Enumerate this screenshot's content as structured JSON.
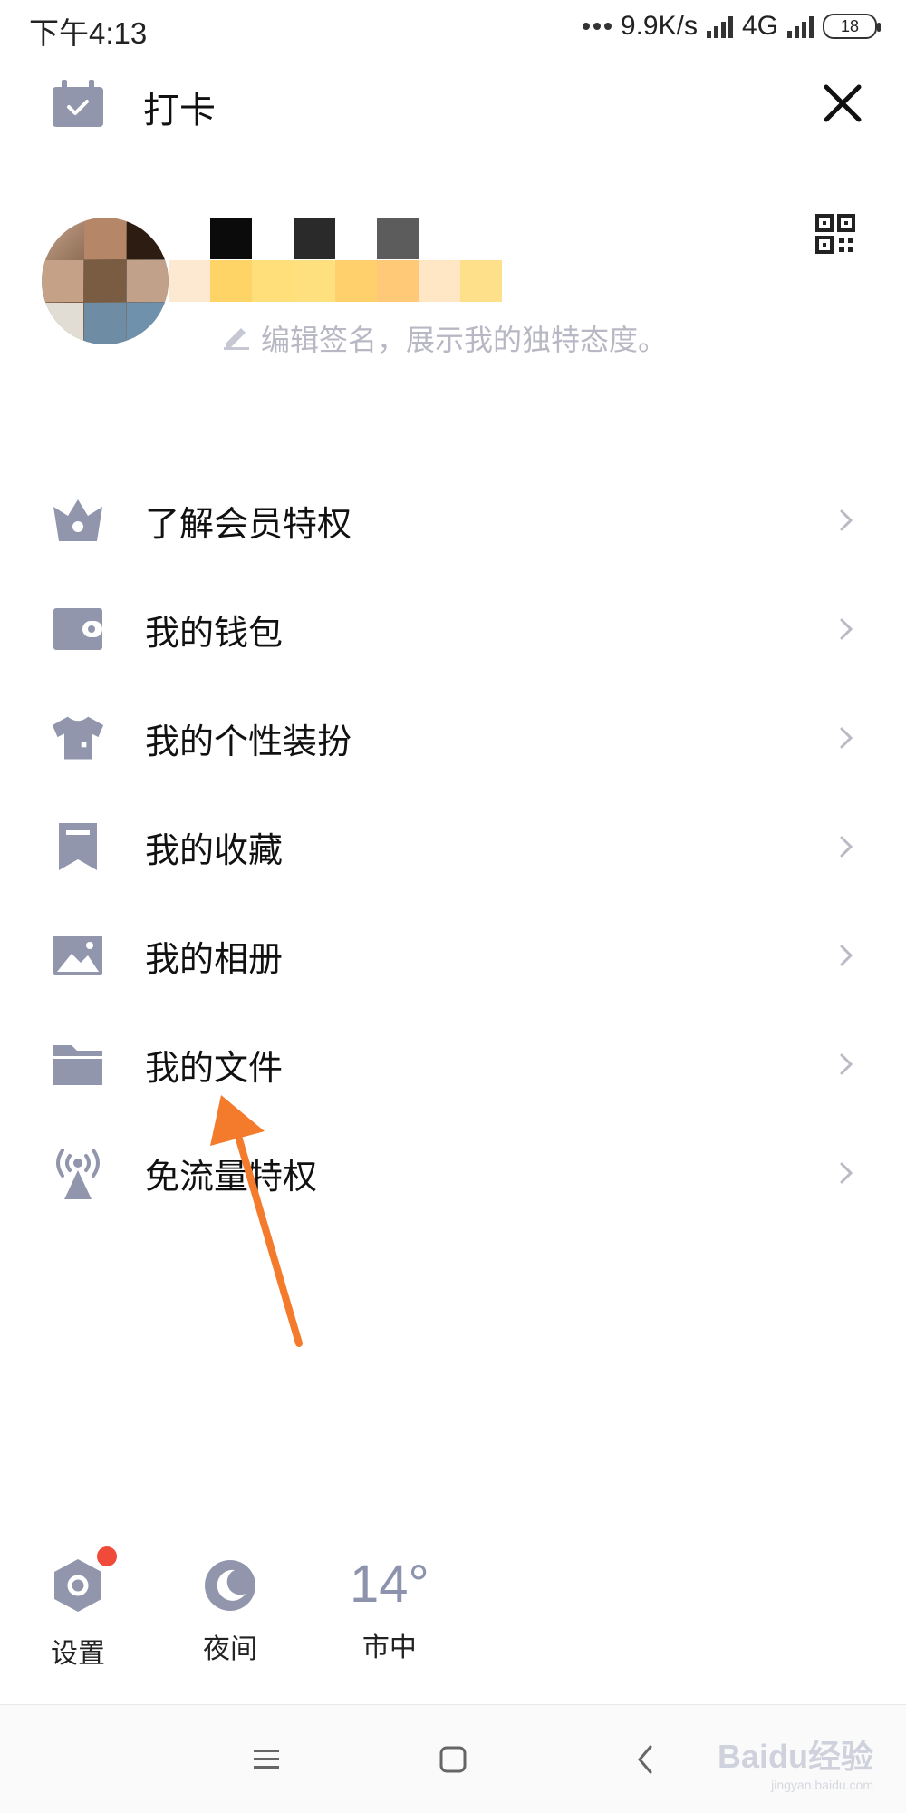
{
  "status_bar": {
    "time": "下午4:13",
    "net_speed": "9.9K/s",
    "network": "4G",
    "battery": "18"
  },
  "header": {
    "checkin_label": "打卡"
  },
  "profile": {
    "signature_placeholder": "编辑签名，展示我的独特态度。"
  },
  "menu": {
    "items": [
      {
        "label": "了解会员特权",
        "icon": "crown-icon"
      },
      {
        "label": "我的钱包",
        "icon": "wallet-icon"
      },
      {
        "label": "我的个性装扮",
        "icon": "shirt-icon"
      },
      {
        "label": "我的收藏",
        "icon": "bookmark-icon"
      },
      {
        "label": "我的相册",
        "icon": "photo-icon"
      },
      {
        "label": "我的文件",
        "icon": "folder-icon"
      },
      {
        "label": "免流量特权",
        "icon": "antenna-icon"
      }
    ]
  },
  "bottom": {
    "settings_label": "设置",
    "night_label": "夜间",
    "weather_temp": "14°",
    "weather_city": "市中"
  },
  "watermark": {
    "brand": "Baidu经验",
    "url": "jingyan.baidu.com"
  },
  "colors": {
    "icon_gray": "#9296ad",
    "arrow": "#f47a2c",
    "badge_red": "#f04a3a"
  }
}
